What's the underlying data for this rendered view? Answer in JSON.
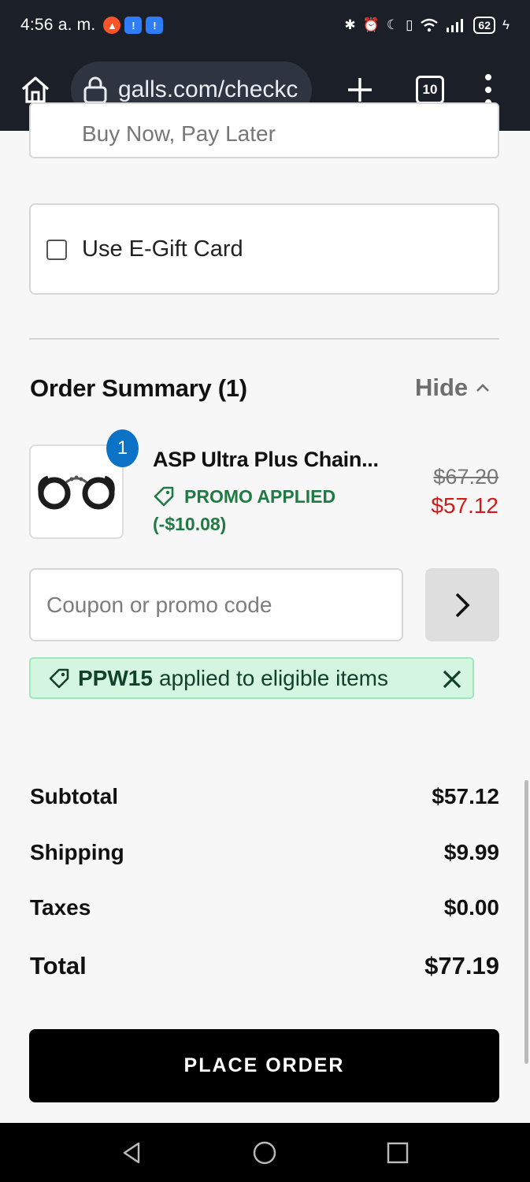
{
  "status_bar": {
    "time": "4:56 a. m.",
    "battery": "62",
    "app_icons": [
      "brave-icon",
      "alert-icon",
      "alert-icon"
    ],
    "system_icons": [
      "bluetooth-icon",
      "alarm-icon",
      "moon-icon",
      "vibrate-icon",
      "wifi-icon",
      "signal-icon",
      "battery-icon",
      "charging-icon"
    ]
  },
  "browser": {
    "url": "galls.com/checkc",
    "tab_count": "10"
  },
  "payment": {
    "bnpl_label": "Buy Now, Pay Later",
    "gift_card_label": "Use E-Gift Card",
    "gift_card_checked": false
  },
  "order_summary": {
    "title": "Order Summary (1)",
    "toggle_label": "Hide",
    "item": {
      "name": "ASP Ultra Plus Chain...",
      "quantity": "1",
      "promo_label": "PROMO APPLIED",
      "promo_amount": "(-$10.08)",
      "original_price": "$67.20",
      "sale_price": "$57.12"
    },
    "coupon": {
      "placeholder": "Coupon or promo code",
      "value": ""
    },
    "applied_promo": {
      "code": "PPW15",
      "message": "applied to eligible items"
    }
  },
  "totals": {
    "subtotal_label": "Subtotal",
    "subtotal_value": "$57.12",
    "shipping_label": "Shipping",
    "shipping_value": "$9.99",
    "taxes_label": "Taxes",
    "taxes_value": "$0.00",
    "total_label": "Total",
    "total_value": "$77.19"
  },
  "actions": {
    "place_order_label": "PLACE ORDER"
  },
  "colors": {
    "promo_green": "#1f7a43",
    "sale_red": "#d11a1a",
    "badge_blue": "#0c72c6",
    "banner_bg": "#d4f5e0"
  }
}
